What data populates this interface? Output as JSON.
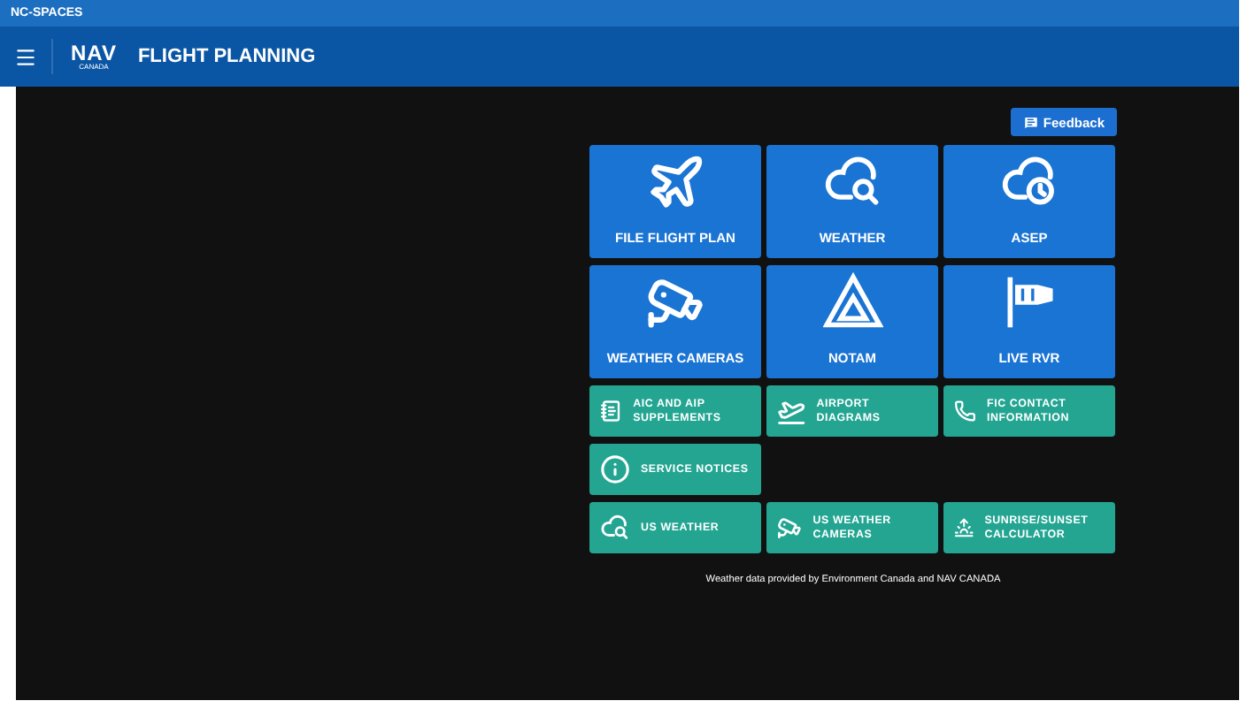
{
  "system_bar": {
    "label": "NC-SPACES"
  },
  "header": {
    "logo_top": "NAV",
    "logo_bottom": "CANADA",
    "title": "FLIGHT PLANNING"
  },
  "feedback_button": {
    "label": "Feedback"
  },
  "tile_rows": [
    {
      "kind": "large",
      "tiles": [
        {
          "label": "FILE FLIGHT PLAN"
        },
        {
          "label": "WEATHER"
        },
        {
          "label": "ASEP"
        }
      ]
    },
    {
      "kind": "large",
      "tiles": [
        {
          "label": "WEATHER CAMERAS"
        },
        {
          "label": "NOTAM"
        },
        {
          "label": "LIVE RVR"
        }
      ]
    },
    {
      "kind": "small",
      "tiles": [
        {
          "label": "AIC AND AIP SUPPLEMENTS"
        },
        {
          "label": "AIRPORT DIAGRAMS"
        },
        {
          "label": "FIC CONTACT INFORMATION"
        }
      ]
    },
    {
      "kind": "small",
      "tiles": [
        {
          "label": "SERVICE NOTICES"
        }
      ]
    },
    {
      "kind": "small",
      "tiles": [
        {
          "label": "US WEATHER"
        },
        {
          "label": "US WEATHER CAMERAS"
        },
        {
          "label": "SUNRISE/SUNSET CALCULATOR"
        }
      ]
    }
  ],
  "footer": "Weather data provided by Environment Canada and NAV CANADA"
}
